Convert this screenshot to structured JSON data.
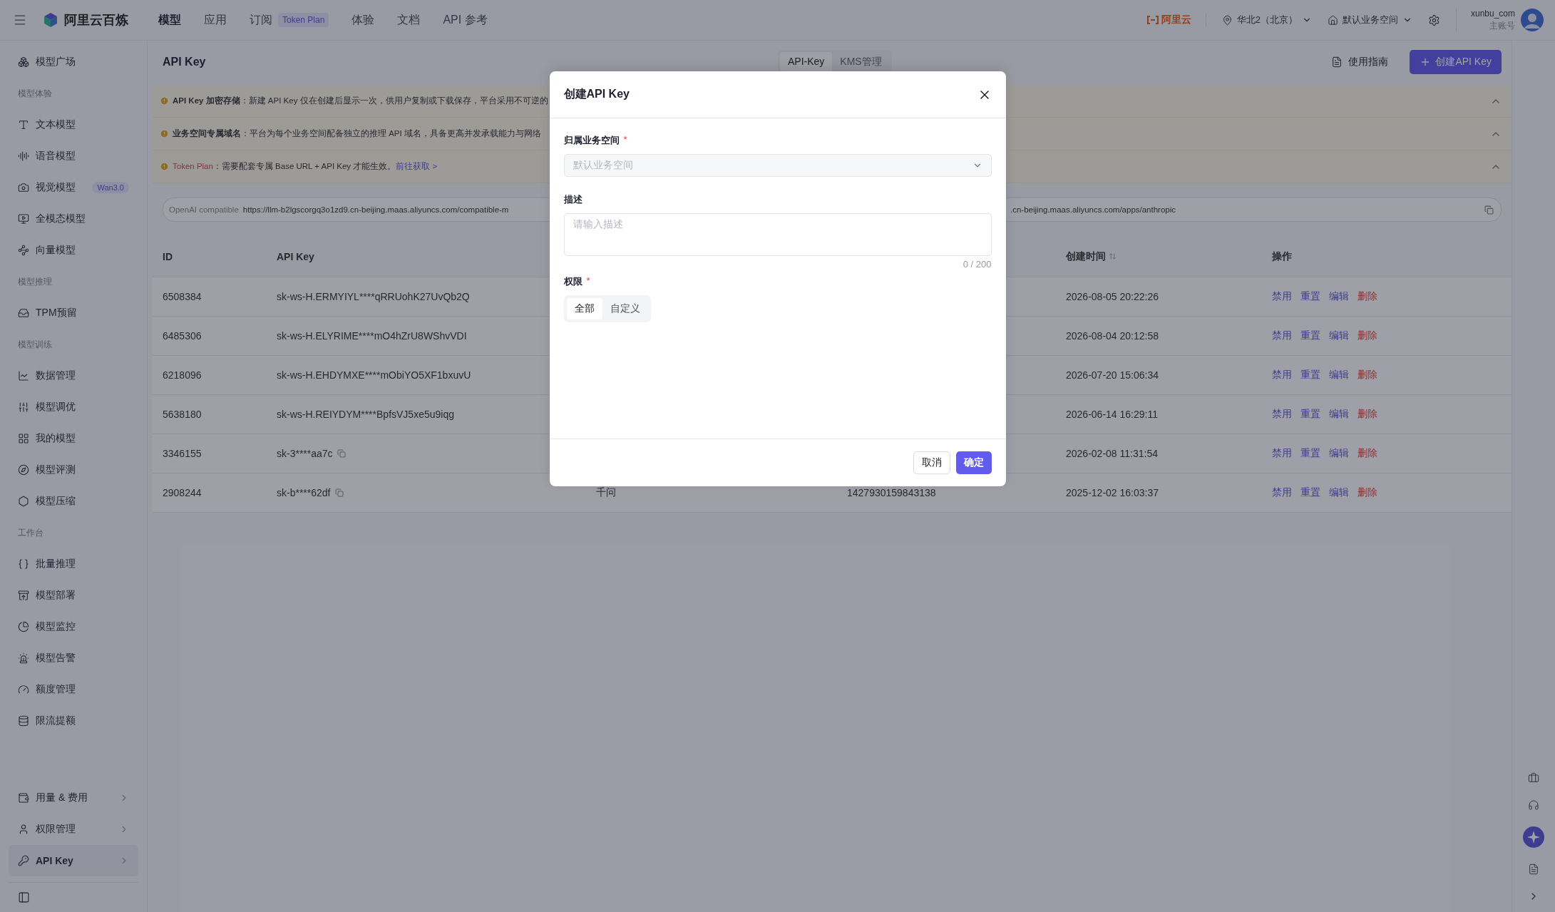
{
  "topbar": {
    "logo_text": "阿里云百炼",
    "nav": [
      {
        "label": "模型",
        "selected": true
      },
      {
        "label": "应用",
        "selected": false
      },
      {
        "label": "订阅",
        "selected": false,
        "badge": "Token Plan"
      },
      {
        "label": "体验",
        "selected": false
      },
      {
        "label": "文档",
        "selected": false
      },
      {
        "label": "API 参考",
        "selected": false
      }
    ],
    "brand": "阿里云",
    "region": "华北2（北京）",
    "workspace": "默认业务空间",
    "user": {
      "name": "xunbu_com",
      "role": "主账号"
    }
  },
  "sidebar": {
    "sections": [
      {
        "items": [
          {
            "label": "模型广场",
            "selected": false
          }
        ]
      },
      {
        "heading": "模型体验",
        "items": [
          {
            "label": "文本模型",
            "selected": false
          },
          {
            "label": "语音模型",
            "selected": false
          },
          {
            "label": "视觉模型",
            "selected": false,
            "badge": "Wan3.0"
          },
          {
            "label": "全模态模型",
            "selected": false
          },
          {
            "label": "向量模型",
            "selected": false
          }
        ]
      },
      {
        "heading": "模型推理",
        "items": [
          {
            "label": "TPM预留",
            "selected": false
          }
        ]
      },
      {
        "heading": "模型训练",
        "items": [
          {
            "label": "数据管理",
            "selected": false
          },
          {
            "label": "模型调优",
            "selected": false
          },
          {
            "label": "我的模型",
            "selected": false
          },
          {
            "label": "模型评测",
            "selected": false
          },
          {
            "label": "模型压缩",
            "selected": false
          }
        ]
      },
      {
        "heading": "工作台",
        "items": [
          {
            "label": "批量推理",
            "selected": false
          },
          {
            "label": "模型部署",
            "selected": false
          },
          {
            "label": "模型监控",
            "selected": false
          },
          {
            "label": "模型告警",
            "selected": false
          },
          {
            "label": "额度管理",
            "selected": false
          },
          {
            "label": "限流提额",
            "selected": false
          }
        ]
      }
    ],
    "footer_items": [
      {
        "label": "用量 & 费用",
        "selected": false
      },
      {
        "label": "权限管理",
        "selected": false
      },
      {
        "label": "API Key",
        "selected": true
      }
    ]
  },
  "page": {
    "title": "API Key",
    "tabs": [
      {
        "label": "API-Key",
        "selected": true
      },
      {
        "label": "KMS管理",
        "selected": false
      }
    ],
    "guide_button": "使用指南",
    "create_button": "创建API Key"
  },
  "banners": [
    {
      "kind": "notice",
      "title": "API Key 加密存储",
      "text": "：新建 API Key 仅在创建后显示一次，供用户复制或下载保存，平台采用不可逆的"
    },
    {
      "kind": "notice",
      "title": "业务空间专属域名",
      "text": "：平台为每个业务空间配备独立的推理 API 域名，具备更高并发承载能力与网络"
    },
    {
      "kind": "plan",
      "title": "Token Plan",
      "text": "：需要配套专属 Base URL + API Key 才能生效。",
      "link": "前往获取 >"
    }
  ],
  "endpoint": {
    "label": "OpenAI compatible",
    "url_start": "https://llm-b2lgscorgq3o1zd9.cn-beijing.maas.aliyuncs.com/compatible-m",
    "url_end": ".cn-beijing.maas.aliyuncs.com/apps/anthropic"
  },
  "table": {
    "columns": {
      "id": "ID",
      "key": "API Key",
      "created": "创建时间",
      "actions": "操作"
    },
    "rows": [
      {
        "id": "6508384",
        "key": "sk-ws-H.ERMYIYL****qRRUohK27UvQb2Q",
        "created": "2026-08-05 20:22:26",
        "actions": [
          {
            "label": "禁用",
            "kind": "normal"
          },
          {
            "label": "重置",
            "kind": "normal"
          },
          {
            "label": "编辑",
            "kind": "normal"
          },
          {
            "label": "删除",
            "kind": "danger"
          }
        ]
      },
      {
        "id": "6485306",
        "key": "sk-ws-H.ELYRIME****mO4hZrU8WShvVDI",
        "created": "2026-08-04 20:12:58",
        "actions": [
          {
            "label": "禁用",
            "kind": "normal"
          },
          {
            "label": "重置",
            "kind": "normal"
          },
          {
            "label": "编辑",
            "kind": "normal"
          },
          {
            "label": "删除",
            "kind": "danger"
          }
        ]
      },
      {
        "id": "6218096",
        "key": "sk-ws-H.EHDYMXE****mObiYO5XF1bxuvU",
        "created": "2026-07-20 15:06:34",
        "actions": [
          {
            "label": "禁用",
            "kind": "normal"
          },
          {
            "label": "重置",
            "kind": "normal"
          },
          {
            "label": "编辑",
            "kind": "normal"
          },
          {
            "label": "删除",
            "kind": "danger"
          }
        ]
      },
      {
        "id": "5638180",
        "key": "sk-ws-H.REIYDYM****BpfsVJ5xe5u9iqg",
        "created": "2026-06-14 16:29:11",
        "actions": [
          {
            "label": "禁用",
            "kind": "normal"
          },
          {
            "label": "重置",
            "kind": "normal"
          },
          {
            "label": "编辑",
            "kind": "normal"
          },
          {
            "label": "删除",
            "kind": "danger"
          }
        ]
      },
      {
        "id": "3346155",
        "key": "sk-3****aa7c",
        "copyable": true,
        "created": "2026-02-08 11:31:54",
        "actions": [
          {
            "label": "禁用",
            "kind": "normal"
          },
          {
            "label": "重置",
            "kind": "normal"
          },
          {
            "label": "编辑",
            "kind": "normal"
          },
          {
            "label": "删除",
            "kind": "danger"
          }
        ]
      },
      {
        "id": "2908244",
        "key": "sk-b****62df",
        "copyable": true,
        "column_3": "千问",
        "column_4": "1427930159843138",
        "created": "2025-12-02 16:03:37",
        "actions": [
          {
            "label": "禁用",
            "kind": "normal"
          },
          {
            "label": "重置",
            "kind": "normal"
          },
          {
            "label": "编辑",
            "kind": "normal"
          },
          {
            "label": "删除",
            "kind": "danger"
          }
        ]
      }
    ]
  },
  "dialog": {
    "title": "创建API Key",
    "required_mark": "*",
    "workspace_label": "归属业务空间",
    "workspace_placeholder": "默认业务空间",
    "description_label": "描述",
    "description_placeholder": "请输入描述",
    "counter": "0 / 200",
    "permission_label": "权限",
    "permission_options": [
      {
        "label": "全部",
        "selected": true
      },
      {
        "label": "自定义",
        "selected": false
      }
    ],
    "cancel": "取消",
    "confirm": "确定"
  }
}
